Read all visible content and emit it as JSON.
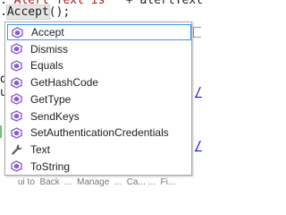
{
  "editor": {
    "line1_prefix": ".",
    "line1_string": "\"Alert Text is \"",
    "line1_suffix": " + alertText",
    "line2_prefix": ".",
    "line2_method": "Accept",
    "line2_suffix": "();",
    "left_fragment_u": "u",
    "left_fragment_d": "d",
    "right_snip_1": "/",
    "right_snip_2": "/",
    "bottom_text": "ui to  Back  ...  Manage  ...  Ca... ...  Fi..."
  },
  "intellisense": {
    "icon_colors": {
      "method": "#8b5fc7",
      "property": "#5a5a5a"
    },
    "items": [
      {
        "label": "Accept",
        "icon": "method-icon",
        "selected": true
      },
      {
        "label": "Dismiss",
        "icon": "method-icon",
        "selected": false
      },
      {
        "label": "Equals",
        "icon": "method-icon",
        "selected": false
      },
      {
        "label": "GetHashCode",
        "icon": "method-icon",
        "selected": false
      },
      {
        "label": "GetType",
        "icon": "method-icon",
        "selected": false
      },
      {
        "label": "SendKeys",
        "icon": "method-icon",
        "selected": false
      },
      {
        "label": "SetAuthenticationCredentials",
        "icon": "method-icon",
        "selected": false
      },
      {
        "label": "Text",
        "icon": "wrench-property-icon",
        "selected": false
      },
      {
        "label": "ToString",
        "icon": "method-icon",
        "selected": false
      }
    ]
  }
}
